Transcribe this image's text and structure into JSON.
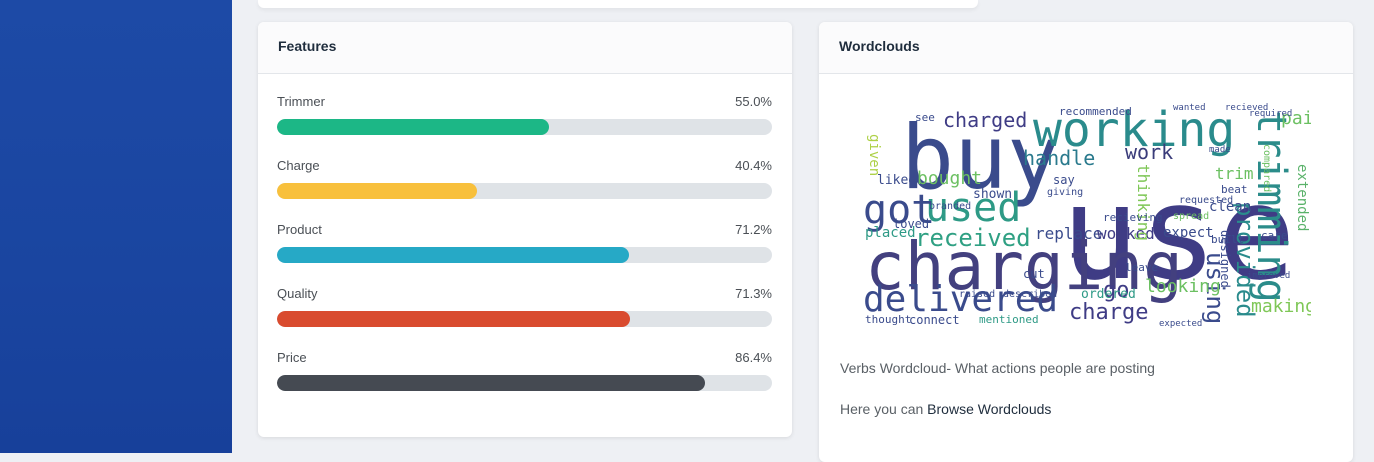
{
  "features": {
    "title": "Features",
    "items": [
      {
        "label": "Trimmer",
        "percent": "55.0%",
        "value": 0.55,
        "color": "#1cb786"
      },
      {
        "label": "Charge",
        "percent": "40.4%",
        "value": 0.404,
        "color": "#f8c03c"
      },
      {
        "label": "Product",
        "percent": "71.2%",
        "value": 0.712,
        "color": "#26a9c6"
      },
      {
        "label": "Quality",
        "percent": "71.3%",
        "value": 0.713,
        "color": "#d94b2f"
      },
      {
        "label": "Price",
        "percent": "86.4%",
        "value": 0.864,
        "color": "#454a52"
      }
    ]
  },
  "wordclouds": {
    "title": "Wordclouds",
    "caption": "Verbs Wordcloud- What actions people are posting",
    "browse_prefix": "Here you can",
    "browse_link": "Browse Wordclouds",
    "words": [
      "use",
      "buy",
      "charging",
      "working",
      "delivered",
      "trimming",
      "used",
      "got",
      "received",
      "charged",
      "handle",
      "work",
      "bought",
      "provided",
      "go",
      "using",
      "charge",
      "looking",
      "making",
      "paid",
      "extended",
      "replace",
      "worked",
      "expect",
      "clean",
      "trim",
      "thinking",
      "placed",
      "liked",
      "given",
      "shown",
      "loved",
      "ordered",
      "connect",
      "thought",
      "mentioned",
      "see",
      "recommended",
      "compared",
      "built",
      "cut",
      "designed",
      "care",
      "say",
      "beat",
      "recieving",
      "spread",
      "leave",
      "requested",
      "described",
      "raised",
      "branded",
      "giving",
      "expected",
      "improved",
      "required",
      "wanted",
      "recieved",
      "made"
    ]
  }
}
